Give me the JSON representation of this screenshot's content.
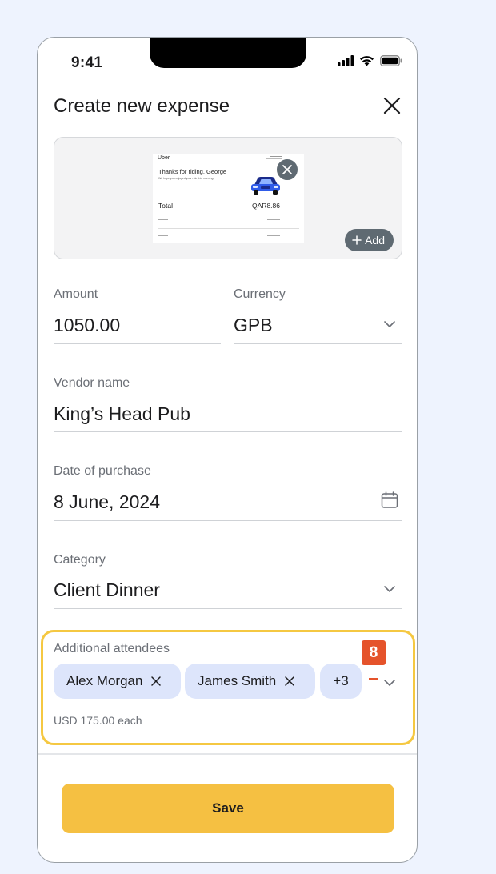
{
  "status_bar": {
    "time": "9:41"
  },
  "header": {
    "title": "Create new expense"
  },
  "receipt": {
    "brand": "Uber",
    "thanks": "Thanks for riding, George",
    "subtext": "We hope you enjoyed your ride this morning.",
    "total_label": "Total",
    "total_value": "QAR8.86",
    "add_label": "Add"
  },
  "form": {
    "amount": {
      "label": "Amount",
      "value": "1050.00"
    },
    "currency": {
      "label": "Currency",
      "value": "GPB"
    },
    "vendor": {
      "label": "Vendor name",
      "value": "King’s Head Pub"
    },
    "date": {
      "label": "Date of purchase",
      "value": "8 June, 2024"
    },
    "category": {
      "label": "Category",
      "value": "Client Dinner"
    },
    "attendees": {
      "label": "Additional attendees",
      "chips": [
        "Alex Morgan",
        "James Smith"
      ],
      "more": "+3",
      "per_person": "USD 175.00 each"
    }
  },
  "annotation": {
    "badge": "8",
    "color": "#e5532b",
    "highlight_color": "#f5c842"
  },
  "footer": {
    "save_label": "Save"
  },
  "colors": {
    "background": "#eef3fe",
    "accent": "#f5c042",
    "chip": "#dde5fb",
    "dark_button": "#5f6a72"
  }
}
